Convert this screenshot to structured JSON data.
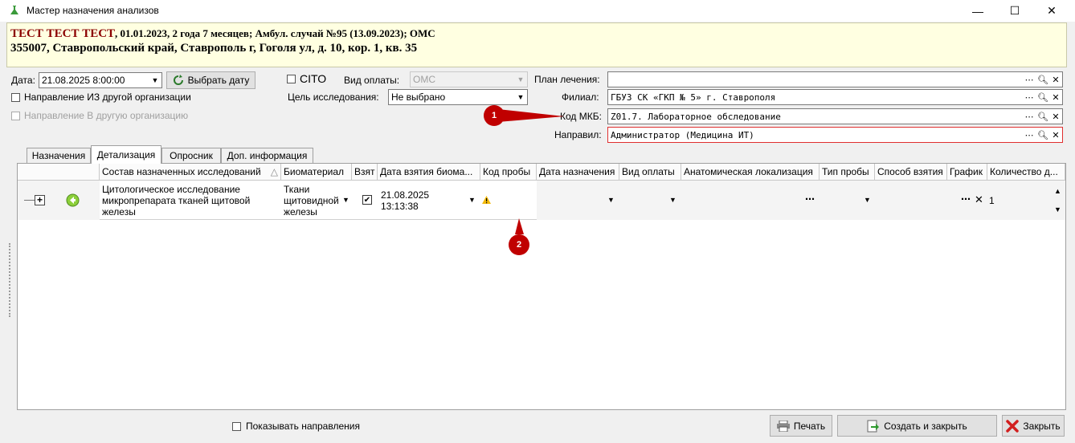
{
  "window": {
    "title": "Мастер назначения анализов",
    "minimize": "—",
    "maximize": "☐",
    "close": "✕"
  },
  "patient": {
    "name": "ТЕСТ ТЕСТ ТЕСТ",
    "info": ", 01.01.2023, 2 года 7 месяцев; Амбул. случай №95 (13.09.2023); ОМС",
    "address": "355007, Ставропольский край, Ставрополь г, Гоголя ул, д. 10, кор. 1, кв. 35"
  },
  "form": {
    "date_label": "Дата:",
    "date_value": "21.08.2025 8:00:00",
    "choose_date_button": "Выбрать дату",
    "cito_label": "CITO",
    "payment_label": "Вид оплаты:",
    "payment_value": "ОМС",
    "from_org_label": "Направление ИЗ другой организации",
    "to_org_label": "Направление В другую организацию",
    "goal_label": "Цель исследования:",
    "goal_value": "Не выбрано",
    "plan_label": "План лечения:",
    "plan_value": "",
    "branch_label": "Филиал:",
    "branch_value": "ГБУЗ СК «ГКП № 5» г. Ставрополя",
    "mkb_label": "Код МКБ:",
    "mkb_value": "Z01.7. Лабораторное обследование",
    "referrer_label": "Направил:",
    "referrer_value": "Администратор (Медицина ИТ)"
  },
  "tabs": [
    "Назначения",
    "Детализация",
    "Опросник",
    "Доп. информация"
  ],
  "grid": {
    "columns": [
      "Состав назначенных исследований",
      "Биоматериал",
      "Взят",
      "Дата взятия биома...",
      "Код пробы",
      "Дата назначения",
      "Вид оплаты",
      "Анатомическая локализация",
      "Тип пробы",
      "Способ взятия",
      "График",
      "Количество д..."
    ],
    "row": {
      "study": "Цитологическое исследование микропрепарата тканей щитовой железы",
      "biomaterial": "Ткани щитовидной железы",
      "taken": "✔",
      "take_date": "21.08.2025 13:13:38",
      "sample_code_icon": "warning-icon",
      "quantity": "1"
    }
  },
  "callouts": [
    "1",
    "2"
  ],
  "footer": {
    "show_directions_label": "Показывать направления",
    "print_button": "Печать",
    "create_close_button": "Создать и закрыть",
    "close_button": "Закрыть"
  },
  "colors": {
    "patient_bg": "#ffffe1",
    "patient_name": "#8b0000",
    "callout": "#c00000",
    "referrer_border": "#e03030"
  }
}
